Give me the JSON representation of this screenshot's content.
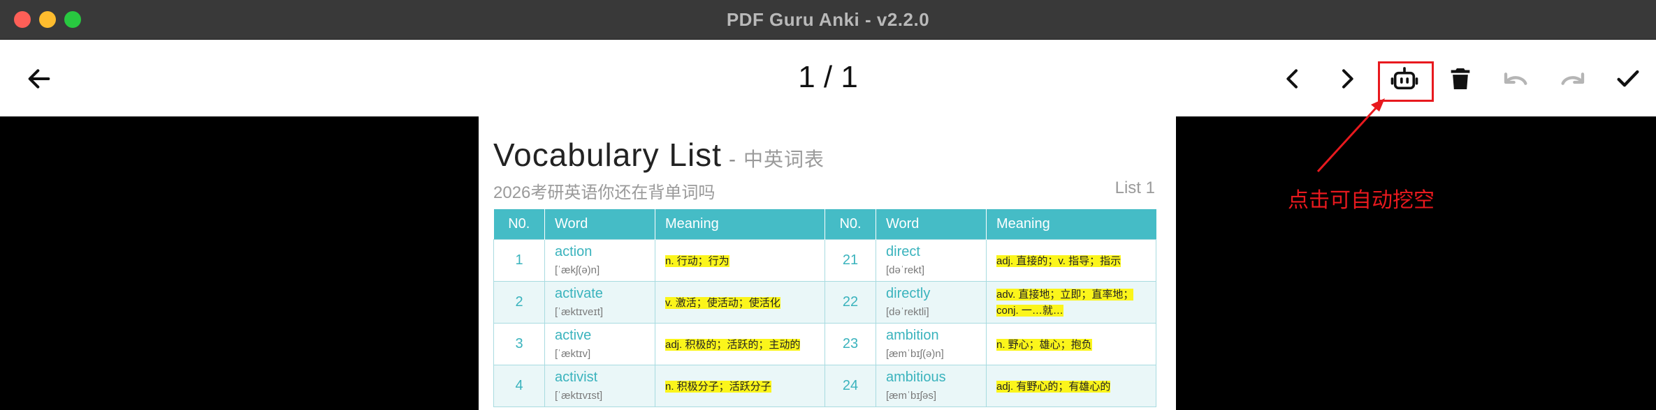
{
  "window": {
    "title": "PDF Guru Anki - v2.2.0"
  },
  "toolbar": {
    "page_indicator": "1 / 1"
  },
  "pdf": {
    "title": "Vocabulary  List",
    "title_sep": "-",
    "title_cn": "中英词表",
    "subtitle": "2026考研英语你还在背单词吗",
    "list_no": "List  1",
    "headers": [
      "N0.",
      "Word",
      "Meaning",
      "N0.",
      "Word",
      "Meaning"
    ],
    "rows": [
      {
        "no1": "1",
        "word1": "action",
        "ph1": "[ˈækʃ(ə)n]",
        "m1": "n. 行动；行为",
        "no2": "21",
        "word2": "direct",
        "ph2": "[dəˈrekt]",
        "m2": "adj. 直接的；v. 指导；指示"
      },
      {
        "no1": "2",
        "word1": "activate",
        "ph1": "[ˈæktɪveɪt]",
        "m1": "v. 激活；使活动；使活化",
        "no2": "22",
        "word2": "directly",
        "ph2": "[dəˈrektli]",
        "m2": "adv. 直接地；立即；直率地；conj. 一…就…"
      },
      {
        "no1": "3",
        "word1": "active",
        "ph1": "[ˈæktɪv]",
        "m1": "adj. 积极的；活跃的；主动的",
        "no2": "23",
        "word2": "ambition",
        "ph2": "[æmˈbɪʃ(ə)n]",
        "m2": "n. 野心；雄心；抱负"
      },
      {
        "no1": "4",
        "word1": "activist",
        "ph1": "[ˈæktɪvɪst]",
        "m1": "n. 积极分子；活跃分子",
        "no2": "24",
        "word2": "ambitious",
        "ph2": "[æmˈbɪʃəs]",
        "m2": "adj. 有野心的；有雄心的"
      }
    ]
  },
  "annotation": {
    "text": "点击可自动挖空",
    "color": "#e8191e"
  },
  "icons": [
    "arrow-left-icon",
    "chevron-left-icon",
    "chevron-right-icon",
    "robot-icon",
    "trash-icon",
    "undo-icon",
    "redo-icon",
    "check-icon"
  ]
}
